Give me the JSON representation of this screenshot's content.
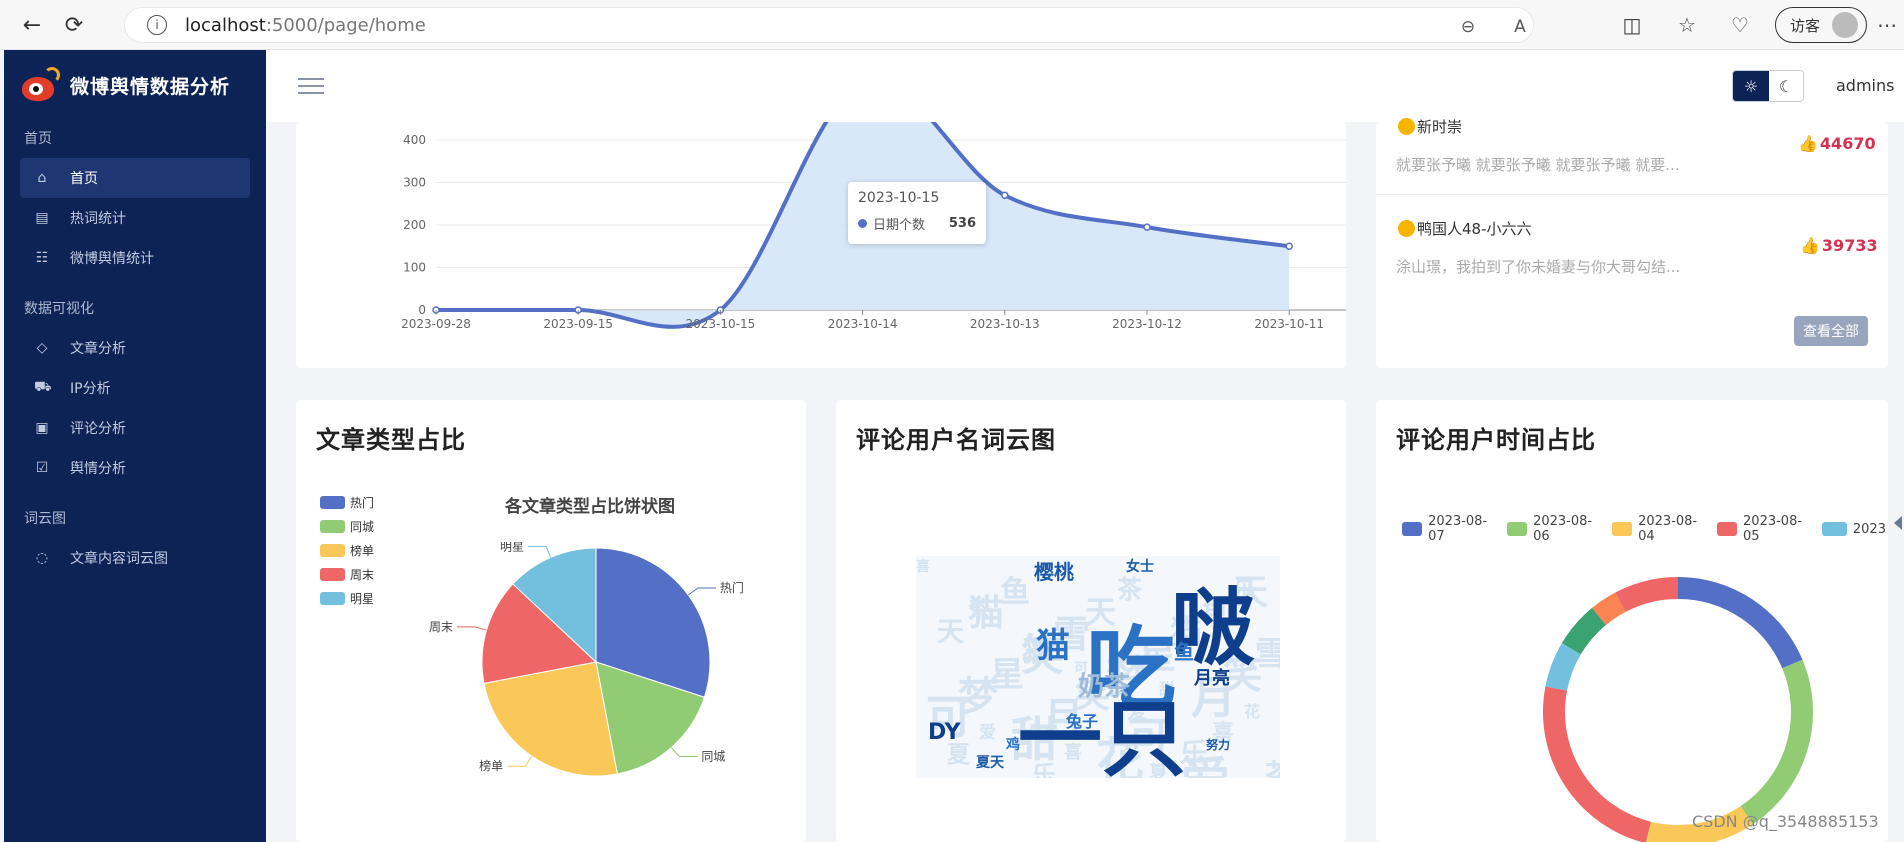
{
  "browser": {
    "url_host": "localhost",
    "url_path": ":5000/page/home",
    "visitor_label": "访客"
  },
  "sidebar": {
    "brand": "微博舆情数据分析",
    "sections": [
      {
        "title": "首页",
        "items": [
          {
            "label": "首页",
            "icon": "home-icon",
            "active": true
          },
          {
            "label": "热词统计",
            "icon": "table-icon"
          },
          {
            "label": "微博舆情统计",
            "icon": "users-icon"
          }
        ]
      },
      {
        "title": "数据可视化",
        "items": [
          {
            "label": "文章分析",
            "icon": "tag-icon"
          },
          {
            "label": "IP分析",
            "icon": "cart-icon"
          },
          {
            "label": "评论分析",
            "icon": "image-icon"
          },
          {
            "label": "舆情分析",
            "icon": "clipboard-icon"
          }
        ]
      },
      {
        "title": "词云图",
        "items": [
          {
            "label": "文章内容词云图",
            "icon": "chat-icon"
          }
        ]
      }
    ]
  },
  "header": {
    "user": "admins"
  },
  "line_chart": {
    "tooltip": {
      "date": "2023-10-15",
      "series": "日期个数",
      "value": "536"
    }
  },
  "top_list": {
    "items": [
      {
        "user": "新时崇",
        "text": "就要张予曦 就要张予曦 就要张予曦 就要...",
        "likes": "44670"
      },
      {
        "user": "鸭国人48-小六六",
        "text": "涂山璟，我拍到了你未婚妻与你大哥勾结...",
        "likes": "39733"
      }
    ],
    "view_all": "查看全部"
  },
  "cards": {
    "pie_title": "文章类型占比",
    "cloud_title": "评论用户名词云图",
    "time_title": "评论用户时间占比"
  },
  "chart_data": [
    {
      "type": "line",
      "x": [
        "2023-09-28",
        "2023-09-15",
        "2023-10-15",
        "2023-10-14",
        "2023-10-13",
        "2023-10-12",
        "2023-10-11"
      ],
      "y": [
        0,
        0,
        0,
        536,
        270,
        195,
        150
      ],
      "ylim": [
        0,
        400
      ],
      "yticks": [
        0,
        100,
        200,
        300,
        400
      ],
      "area": true,
      "color": "#5470c6"
    },
    {
      "type": "pie",
      "title": "各文章类型占比饼状图",
      "categories": [
        "热门",
        "同城",
        "榜单",
        "周末",
        "明星"
      ],
      "values": [
        30,
        17,
        25,
        15,
        13
      ],
      "colors": [
        "#5470c6",
        "#91cc75",
        "#fac858",
        "#ee6666",
        "#73c0de"
      ]
    },
    {
      "type": "pie",
      "categories": [
        "2023-08-07",
        "2023-08-06",
        "2023-08-04",
        "2023-08-05",
        "2023"
      ],
      "values": [
        17,
        20,
        12,
        22,
        5,
        5,
        3,
        7
      ],
      "colors": [
        "#5470c6",
        "#91cc75",
        "#fac858",
        "#ee6666",
        "#73c0de",
        "#3ba272",
        "#fc8452",
        "#ee6666"
      ],
      "donut": true
    }
  ],
  "wordcloud": {
    "words": [
      "吃",
      "啵",
      "一只",
      "猫",
      "樱桃",
      "月亮",
      "鱼",
      "兔子",
      "女士",
      "努力",
      "DY",
      "夏天",
      "鸡",
      "奶茶"
    ]
  },
  "watermark": "CSDN @q_3548885153",
  "colors": {
    "sidebar": "#0d2356",
    "accent": "#5470c6",
    "like": "#d53152"
  }
}
